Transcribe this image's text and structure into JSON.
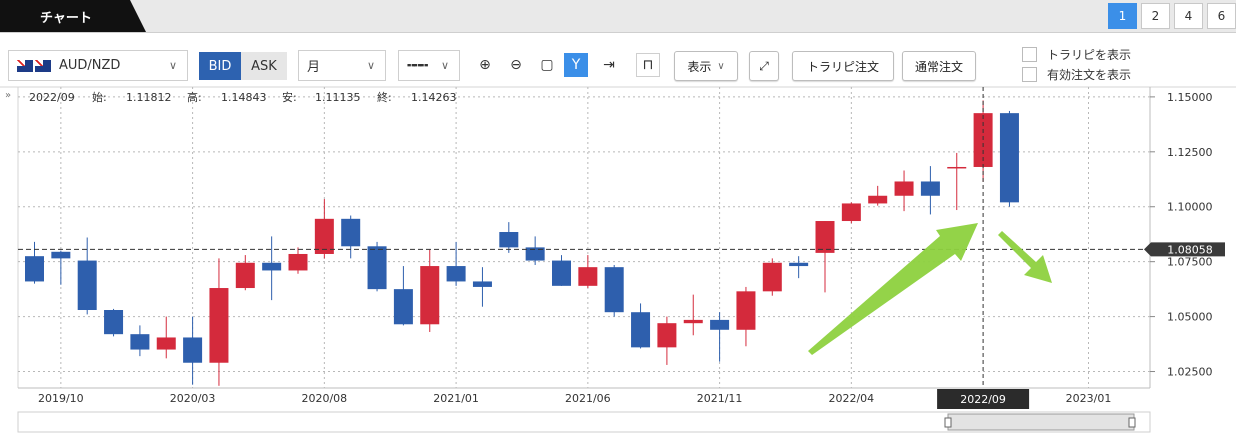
{
  "header": {
    "title": "チャート",
    "pages": [
      "1",
      "2",
      "4",
      "6"
    ],
    "active_page": "1"
  },
  "toolbar": {
    "pair": "AUD/NZD",
    "bid": "BID",
    "ask": "ASK",
    "period": "月",
    "display": "表示",
    "trapi_order": "トラリピ注文",
    "normal_order": "通常注文",
    "show_trapi": "トラリピを表示",
    "show_valid_orders": "有効注文を表示",
    "colors": {
      "bid_active": "#2d62b0",
      "accent": "#3b8fe8"
    }
  },
  "ohlc": {
    "date": "2022/09",
    "open_label": "始:",
    "open": "1.11812",
    "high_label": "高:",
    "high": "1.14843",
    "low_label": "安:",
    "low": "1.11135",
    "close_label": "終:",
    "close": "1.14263"
  },
  "current_price_label": "1.08058",
  "x_highlight_label": "2022/09",
  "chart_data": {
    "type": "candlestick",
    "categories": [
      "2019/09",
      "2019/10",
      "2019/11",
      "2019/12",
      "2020/01",
      "2020/02",
      "2020/03",
      "2020/04",
      "2020/05",
      "2020/06",
      "2020/07",
      "2020/08",
      "2020/09",
      "2020/10",
      "2020/11",
      "2020/12",
      "2021/01",
      "2021/02",
      "2021/03",
      "2021/04",
      "2021/05",
      "2021/06",
      "2021/07",
      "2021/08",
      "2021/09",
      "2021/10",
      "2021/11",
      "2021/12",
      "2022/01",
      "2022/02",
      "2022/03",
      "2022/04",
      "2022/05",
      "2022/06",
      "2022/07",
      "2022/08",
      "2022/09",
      "2022/10"
    ],
    "open": [
      1.0775,
      1.0795,
      1.0755,
      1.053,
      1.042,
      1.035,
      1.0405,
      1.029,
      1.063,
      1.0745,
      1.071,
      1.0785,
      1.0945,
      1.082,
      1.0625,
      1.0465,
      1.073,
      1.066,
      1.0885,
      1.0815,
      1.0755,
      1.064,
      1.0725,
      1.052,
      1.036,
      1.047,
      1.0485,
      1.044,
      1.0615,
      1.0745,
      1.079,
      1.0935,
      1.1015,
      1.105,
      1.1115,
      1.1175,
      1.1181,
      1.1426
    ],
    "close": [
      1.066,
      1.0765,
      1.053,
      1.042,
      1.035,
      1.0405,
      1.029,
      1.063,
      1.0745,
      1.071,
      1.0785,
      1.0945,
      1.082,
      1.0625,
      1.0465,
      1.073,
      1.066,
      1.0635,
      1.0815,
      1.0755,
      1.064,
      1.0725,
      1.052,
      1.036,
      1.047,
      1.0485,
      1.044,
      1.0615,
      1.0745,
      1.073,
      1.0935,
      1.1015,
      1.105,
      1.1115,
      1.105,
      1.1181,
      1.1426,
      1.102
    ],
    "high": [
      1.084,
      1.08,
      1.086,
      1.0535,
      1.046,
      1.05,
      1.05,
      1.0765,
      1.078,
      1.0865,
      1.0815,
      1.1035,
      1.096,
      1.084,
      1.073,
      1.0805,
      1.084,
      1.0725,
      1.093,
      1.0865,
      1.078,
      1.078,
      1.0735,
      1.056,
      1.05,
      1.06,
      1.052,
      1.0635,
      1.0765,
      1.0775,
      1.0935,
      1.102,
      1.1095,
      1.1165,
      1.1185,
      1.1245,
      1.1484,
      1.1436
    ],
    "low": [
      1.065,
      1.0645,
      1.051,
      1.041,
      1.032,
      1.031,
      1.019,
      1.0185,
      1.062,
      1.0575,
      1.0695,
      1.0765,
      1.0765,
      1.0615,
      1.046,
      1.043,
      1.064,
      1.0545,
      1.079,
      1.0735,
      1.064,
      1.063,
      1.05,
      1.0355,
      1.028,
      1.0415,
      1.0295,
      1.0365,
      1.0595,
      1.0675,
      1.061,
      1.0925,
      1.1005,
      1.098,
      1.0965,
      1.0985,
      1.1114,
      1.1
    ],
    "ylim": [
      1.0175,
      1.1545
    ],
    "y_ticks": [
      "1.15000",
      "1.12500",
      "1.10000",
      "1.07500",
      "1.05000",
      "1.02500"
    ],
    "x_tick_labels": [
      {
        "label": "2019/10",
        "index": 1
      },
      {
        "label": "2020/03",
        "index": 6
      },
      {
        "label": "2020/08",
        "index": 11
      },
      {
        "label": "2021/01",
        "index": 16
      },
      {
        "label": "2021/06",
        "index": 21
      },
      {
        "label": "2021/11",
        "index": 26
      },
      {
        "label": "2022/04",
        "index": 31
      },
      {
        "label": "2023/01",
        "index": 40
      }
    ],
    "current_price": 1.08058,
    "crosshair_index": 36,
    "colors": {
      "up": "#d42a3c",
      "down": "#2e5fad",
      "arrow": "#8ed13f"
    },
    "grid": true
  }
}
